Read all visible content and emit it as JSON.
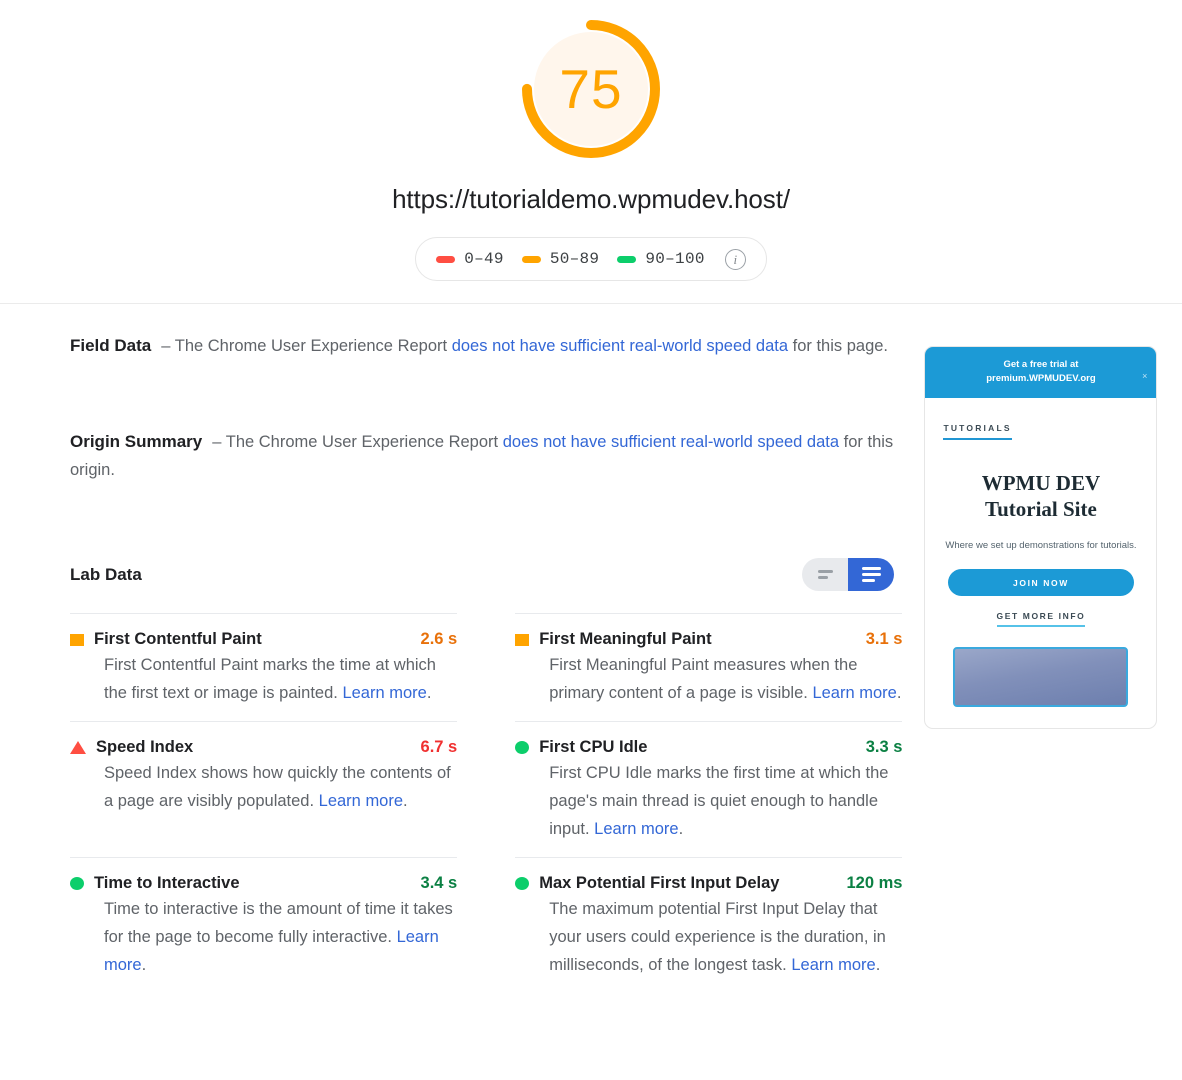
{
  "score": {
    "value": "75",
    "percent": 75,
    "color": "#FFA400",
    "track_color": "#FFF6EC",
    "url": "https://tutorialdemo.wpmudev.host/"
  },
  "legend": {
    "items": [
      {
        "label": "0–49",
        "color": "#FF4E42",
        "name": "legend-red"
      },
      {
        "label": "50–89",
        "color": "#FFA400",
        "name": "legend-orange"
      },
      {
        "label": "90–100",
        "color": "#0CCE6B",
        "name": "legend-green"
      }
    ],
    "info_glyph": "i"
  },
  "field_data": {
    "title": "Field Data",
    "dash": "–",
    "text_before": "The Chrome User Experience Report",
    "link": "does not have sufficient real-world speed data",
    "text_after": "for this page."
  },
  "origin_summary": {
    "title": "Origin Summary",
    "dash": "–",
    "text_before": "The Chrome User Experience Report",
    "link": "does not have sufficient real-world speed data",
    "text_after": "for this origin."
  },
  "lab_data": {
    "title": "Lab Data",
    "toggle": {
      "left_option": "compact-view",
      "right_option": "expanded-view",
      "active": "expanded-view"
    },
    "metrics": [
      {
        "name": "First Contentful Paint",
        "value": "2.6 s",
        "status": "average",
        "icon": "square",
        "value_color": "#E8710A",
        "description": "First Contentful Paint marks the time at which the first text or image is painted.",
        "link": "Learn more",
        "link_suffix": "."
      },
      {
        "name": "First Meaningful Paint",
        "value": "3.1 s",
        "status": "average",
        "icon": "square",
        "value_color": "#E8710A",
        "description": "First Meaningful Paint measures when the primary content of a page is visible.",
        "link": "Learn more",
        "link_suffix": "."
      },
      {
        "name": "Speed Index",
        "value": "6.7 s",
        "status": "slow",
        "icon": "triangle",
        "value_color": "#F03030",
        "description": "Speed Index shows how quickly the contents of a page are visibly populated.",
        "link": "Learn more",
        "link_suffix": "."
      },
      {
        "name": "First CPU Idle",
        "value": "3.3 s",
        "status": "fast",
        "icon": "circle",
        "value_color": "#0B8043",
        "description": "First CPU Idle marks the first time at which the page's main thread is quiet enough to handle input.",
        "link": "Learn more",
        "link_suffix": "."
      },
      {
        "name": "Time to Interactive",
        "value": "3.4 s",
        "status": "fast",
        "icon": "circle",
        "value_color": "#0B8043",
        "description": "Time to interactive is the amount of time it takes for the page to become fully interactive.",
        "link": "Learn more",
        "link_suffix": "."
      },
      {
        "name": "Max Potential First Input Delay",
        "value": "120 ms",
        "status": "fast",
        "icon": "circle",
        "value_color": "#0B8043",
        "description": "The maximum potential First Input Delay that your users could experience is the duration, in milliseconds, of the longest task.",
        "link": "Learn more",
        "link_suffix": "."
      }
    ]
  },
  "screenshot": {
    "banner_line1": "Get a free trial at",
    "banner_line2": "premium.WPMUDEV.org",
    "banner_close": "×",
    "kicker": "TUTORIALS",
    "title_line1": "WPMU DEV",
    "title_line2": "Tutorial Site",
    "subtitle": "Where we set up demonstrations for tutorials.",
    "cta": "JOIN NOW",
    "secondary_link": "GET MORE INFO"
  }
}
